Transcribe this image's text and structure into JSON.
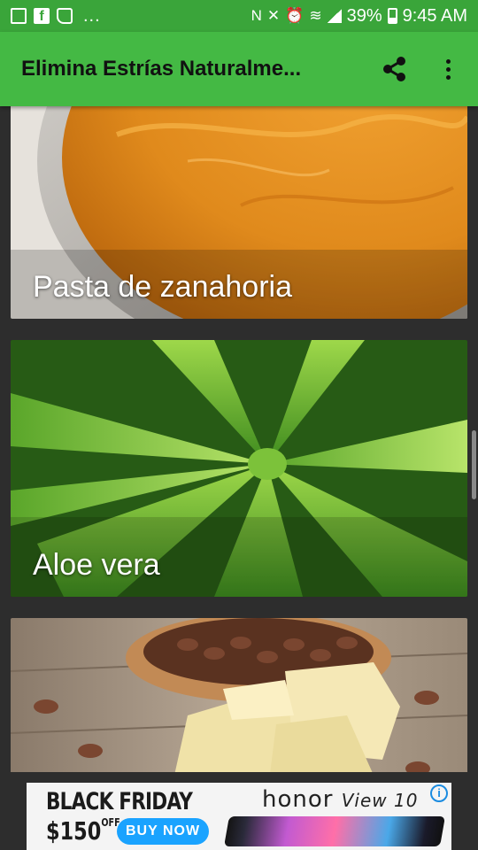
{
  "status_bar": {
    "notification_more": "...",
    "battery_percent": "39%",
    "time": "9:45 AM"
  },
  "app_bar": {
    "title": "Elimina Estrías Naturalme...",
    "share_icon": "share-icon",
    "more_icon": "more-vert-icon"
  },
  "cards": [
    {
      "label": "Pasta de zanahoria",
      "image": "carrot-paste-bowl"
    },
    {
      "label": "Aloe vera",
      "image": "aloe-vera-plant"
    },
    {
      "label": "",
      "image": "cocoa-butter-and-beans"
    }
  ],
  "ad": {
    "headline": "BLACK FRIDAY",
    "price": "$150",
    "price_suffix": "OFF",
    "cta": "BUY NOW",
    "brand": "honor",
    "model": "View 10",
    "info_icon": "info-icon"
  },
  "colors": {
    "status_bar": "#3aa53a",
    "app_bar": "#44b944",
    "background": "#2d2d2d",
    "ad_cta": "#1aa3ff"
  }
}
